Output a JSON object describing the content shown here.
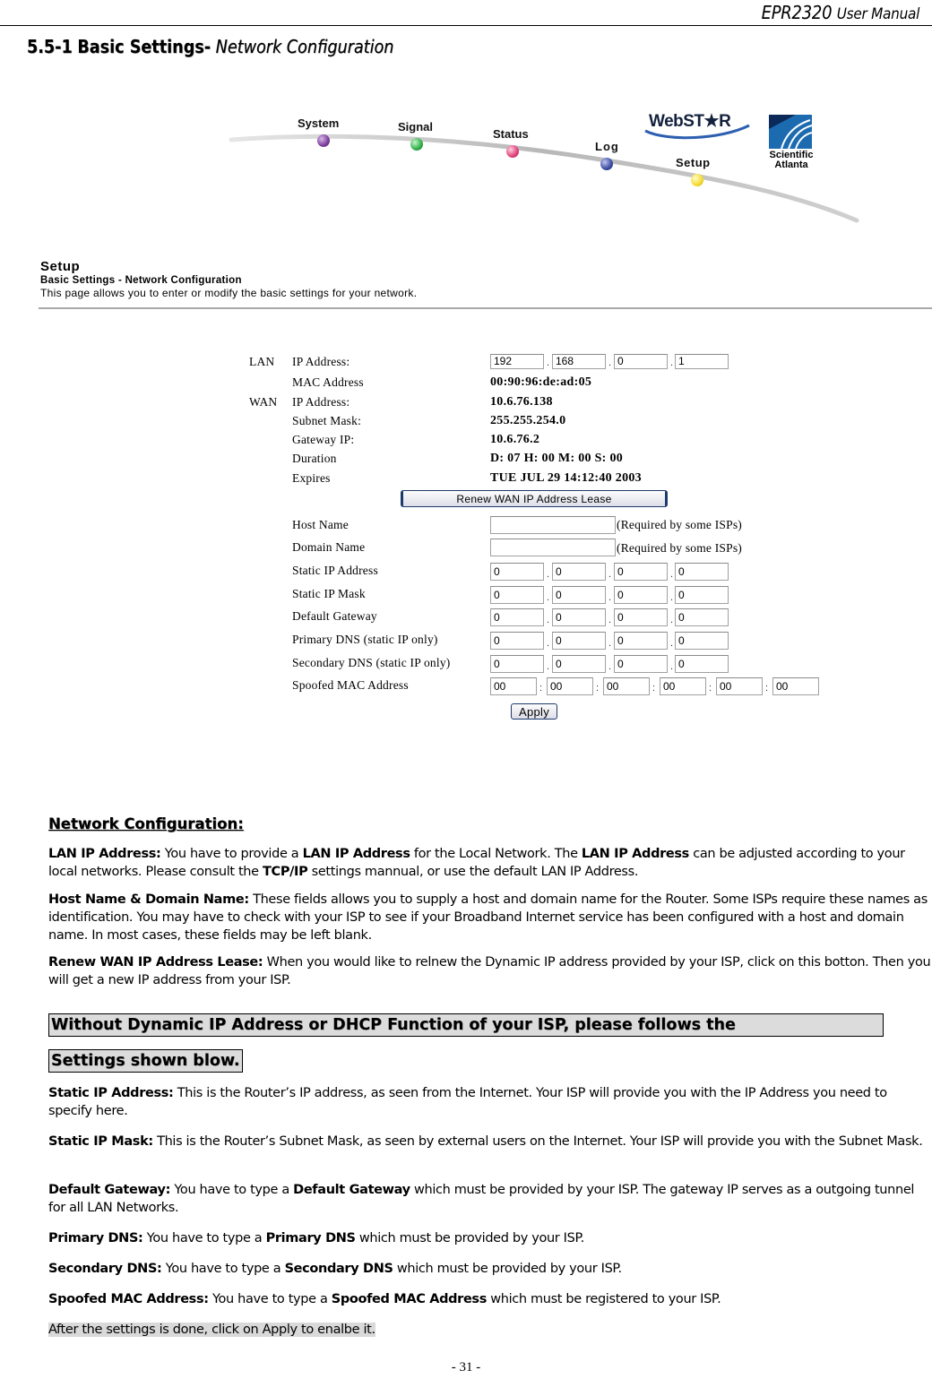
{
  "doc_header": {
    "model": "EPR2320",
    "suffix": "User Manual"
  },
  "section_title": {
    "number": "5.5-1",
    "bold": "Basic Settings-",
    "italic": "Network Configuration"
  },
  "nav": {
    "items": [
      {
        "label": "System",
        "color": "#7a3c9a"
      },
      {
        "label": "Signal",
        "color": "#2fae47"
      },
      {
        "label": "Status",
        "color": "#e0407a"
      },
      {
        "label": "Log",
        "color": "#3a4aa0"
      },
      {
        "label": "Setup",
        "color": "#f4dc2e"
      }
    ],
    "webstar_logo": "WebST★R",
    "sa_logo_line1": "Scientific",
    "sa_logo_line2": "Atlanta"
  },
  "setup": {
    "title": "Setup",
    "subtitle": "Basic Settings - Network Configuration",
    "description": "This page allows you to enter or modify the basic settings for your network."
  },
  "form": {
    "lan_group": "LAN",
    "wan_group": "WAN",
    "lan_ip_label": "IP Address:",
    "lan_ip": [
      "192",
      "168",
      "0",
      "1"
    ],
    "mac_label": "MAC Address",
    "mac_value": "00:90:96:de:ad:05",
    "wan_ip_label": "IP Address:",
    "wan_ip_value": "10.6.76.138",
    "subnet_label": "Subnet Mask:",
    "subnet_value": "255.255.254.0",
    "gateway_label": "Gateway IP:",
    "gateway_value": "10.6.76.2",
    "duration_label": "Duration",
    "duration_value": "D: 07 H: 00 M: 00 S: 00",
    "expires_label": "Expires",
    "expires_value": "TUE JUL 29 14:12:40 2003",
    "renew_button": "Renew WAN IP Address Lease",
    "host_label": "Host Name",
    "host_value": "",
    "host_note": "(Required by some ISPs)",
    "domain_label": "Domain Name",
    "domain_value": "",
    "domain_note": "(Required by some ISPs)",
    "static_ip_label": "Static IP Address",
    "static_ip": [
      "0",
      "0",
      "0",
      "0"
    ],
    "static_mask_label": "Static IP Mask",
    "static_mask": [
      "0",
      "0",
      "0",
      "0"
    ],
    "default_gw_label": "Default Gateway",
    "default_gw": [
      "0",
      "0",
      "0",
      "0"
    ],
    "primary_dns_label": "Primary DNS (static IP only)",
    "primary_dns": [
      "0",
      "0",
      "0",
      "0"
    ],
    "secondary_dns_label": "Secondary DNS (static IP only)",
    "secondary_dns": [
      "0",
      "0",
      "0",
      "0"
    ],
    "spoofed_mac_label": "Spoofed MAC Address",
    "spoofed_mac": [
      "00",
      "00",
      "00",
      "00",
      "00",
      "00"
    ],
    "ip_sep": ".",
    "mac_sep": ":",
    "apply_button": "Apply"
  },
  "doc": {
    "heading": "Network Configuration:",
    "lan_ip": {
      "term": "LAN IP Address:",
      "t1": " You have to provide a ",
      "b1": "LAN IP Address",
      "t2": " for the Local Network. The ",
      "b2": "LAN IP Address",
      "t3": " can be adjusted according to your local networks.   Please consult the ",
      "b3": "TCP/IP",
      "t4": " settings mannual, or use the default LAN IP Address."
    },
    "host_domain": {
      "term": "Host Name & Domain Name:",
      "text": " These fields allows you to supply a host and domain name for the Router. Some ISPs require these names as identification. You may have to check with your ISP to see if your Broadband Internet service has been configured with a host and domain name. In most cases, these fields may be left blank."
    },
    "renew": {
      "term": "Renew WAN IP Address Lease:",
      "text": " When you would like to relnew the Dynamic IP address provided by your ISP, click on this botton. Then you will get a new IP address from your ISP."
    },
    "boxed_line1": "Without Dynamic IP Address or DHCP Function of your ISP, please follows the",
    "boxed_line2": "Settings shown blow.",
    "static_ip": {
      "term": "Static IP Address:",
      "text": " This is the Router’s IP address, as seen from the Internet. Your ISP will provide you with the IP Address you need to specify here."
    },
    "static_mask": {
      "term": "Static IP Mask:",
      "text": " This is the Router’s Subnet Mask, as seen by external users on the Internet. Your ISP will provide you with the Subnet Mask."
    },
    "default_gw": {
      "term": "Default Gateway:",
      "t1": " You have to type a ",
      "b1": "Default Gateway",
      "t2": " which must be provided by your ISP. The gateway IP serves as a outgoing tunnel for all LAN Networks."
    },
    "primary_dns": {
      "term": "Primary DNS:",
      "t1": " You have to type a ",
      "b1": "Primary DNS",
      "t2": " which must be provided by your ISP."
    },
    "secondary_dns": {
      "term": "Secondary DNS:",
      "t1": " You have to type a ",
      "b1": "Secondary DNS",
      "t2": " which must be provided by your ISP."
    },
    "spoofed_mac": {
      "term": "Spoofed MAC Address:",
      "t1": " You have to type a ",
      "b1": "Spoofed MAC Address",
      "t2": " which must be registered to your ISP."
    },
    "after_note": "After the settings is done, click on Apply to enalbe it."
  },
  "page_number": "- 31 -"
}
